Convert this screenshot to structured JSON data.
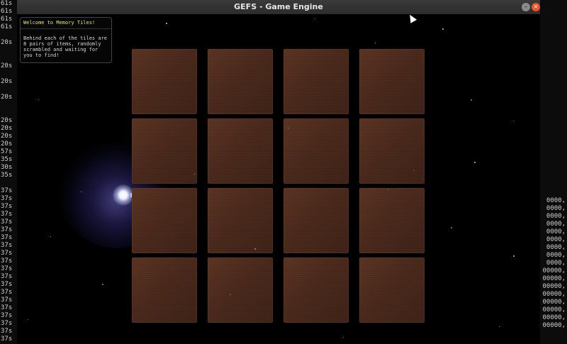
{
  "window": {
    "title": "GEFS - Game Engine",
    "minimize_glyph": "–",
    "close_glyph": "×"
  },
  "info_panel": {
    "title": "Welcome to Memory Tiles!",
    "body": "Behind each of the tiles are 8 pairs of items, randomly scrambled and waiting for you to find!"
  },
  "board": {
    "rows": 4,
    "columns": 4,
    "tile_color": "#4a291b",
    "tiles_face_down": 16
  },
  "terminal_left": {
    "lines": [
      "61s",
      "61s",
      "61s",
      "61s",
      "",
      "20s",
      "",
      "",
      "20s",
      "",
      "20s",
      "",
      "20s",
      "",
      "",
      "20s",
      "20s",
      "20s",
      "20s",
      "57s",
      "35s",
      "30s",
      "35s",
      "",
      "37s",
      "37s",
      "37s",
      "37s",
      "37s",
      "37s",
      "37s",
      "37s",
      "37s",
      "37s",
      "37s",
      "37s",
      "37s",
      "37s",
      "37s",
      "37s",
      "37s",
      "37s",
      "37s",
      "37s"
    ]
  },
  "terminal_right": {
    "lines": [
      "0000,",
      "0000,",
      "0000,",
      "0000,",
      "0000,",
      "0000,",
      "0000,",
      "0000,",
      "0000,",
      "00000,",
      "00000,",
      "00000,",
      "00000,",
      "00000,",
      "00000,",
      "00000,",
      "00000,"
    ]
  },
  "colors": {
    "background": "#000000",
    "titlebar": "#2c2c2c",
    "panel_title": "#e8e86a",
    "close_button": "#e95420"
  }
}
